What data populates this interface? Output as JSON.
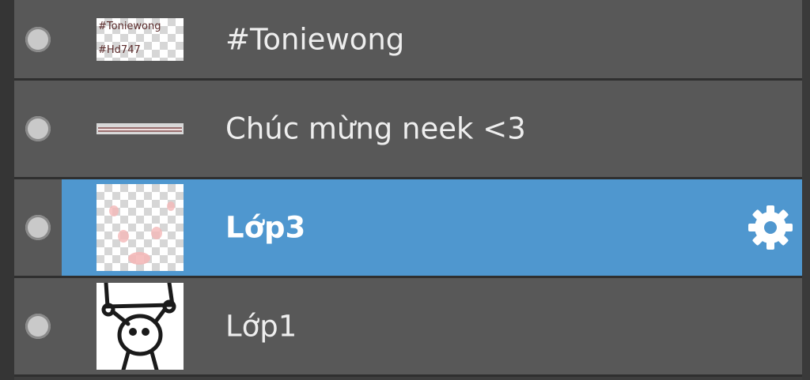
{
  "layers": [
    {
      "name": "#Toniewong",
      "selected": false,
      "thumb_text_line1": "#Toniewong",
      "thumb_text_line2": "#Hd747"
    },
    {
      "name": "Chúc mừng neek <3",
      "selected": false
    },
    {
      "name": "Lớp3",
      "selected": true
    },
    {
      "name": "Lớp1",
      "selected": false
    }
  ],
  "colors": {
    "row_bg": "#585858",
    "selected_bg": "#4f97cf",
    "separator": "#2f2f2f"
  },
  "icons": {
    "visibility": "visibility-dot-icon",
    "settings": "gear-icon"
  }
}
